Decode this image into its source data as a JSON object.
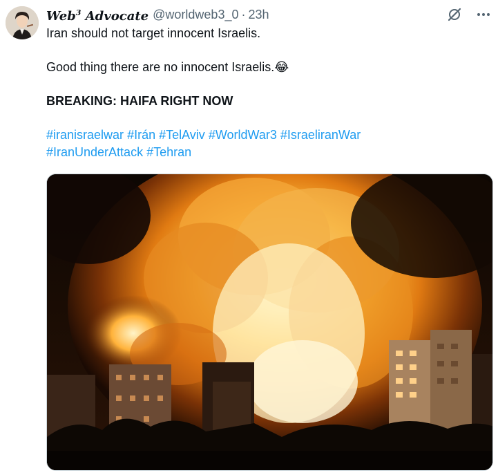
{
  "tweet": {
    "author": {
      "display_name_prefix": "Web",
      "display_name_superscript": "3",
      "display_name_suffix": " Advocate",
      "handle": "@worldweb3_0",
      "separator": "·",
      "time": "23h"
    },
    "text": {
      "line1": "Iran should not target innocent Israelis.",
      "line2": "Good thing there are no innocent Israelis.",
      "emoji": "😂",
      "line3": "BREAKING: HAIFA RIGHT NOW"
    },
    "hashtags": [
      "#iranisraelwar",
      "#Irán",
      "#TelAviv",
      "#WorldWar3",
      "#IsraeliranWar",
      "#IranUnderAttack",
      "#Tehran"
    ],
    "icons": {
      "grok": "grok-icon",
      "more": "more-icon"
    },
    "colors": {
      "link": "#1d9bf0",
      "secondary_text": "#536471",
      "primary_text": "#0f1419"
    }
  }
}
